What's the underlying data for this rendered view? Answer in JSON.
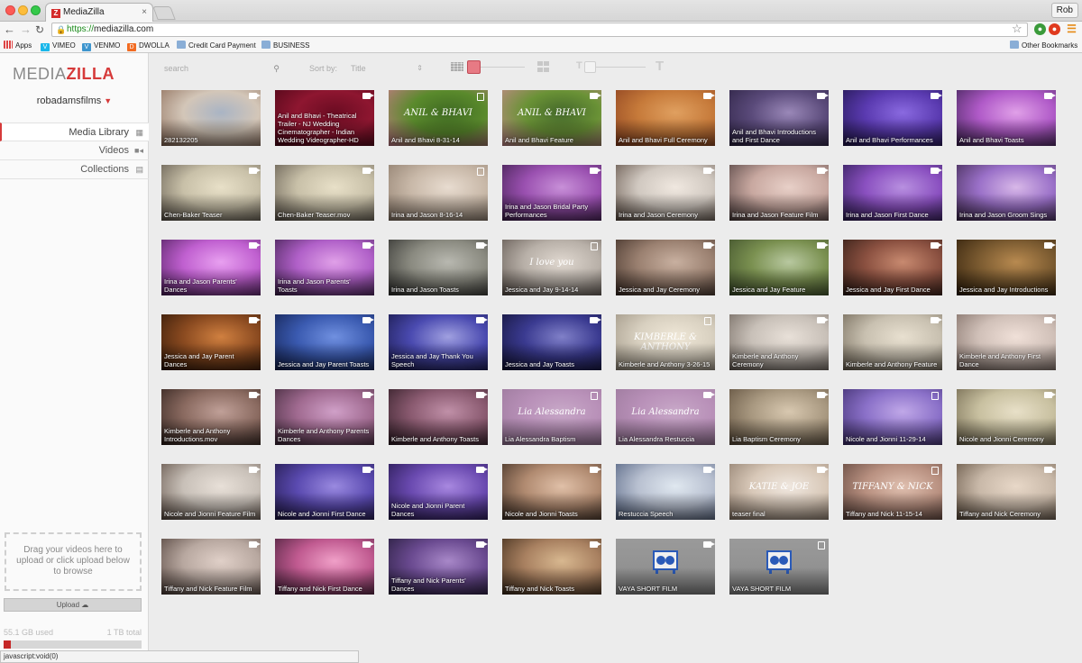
{
  "browser": {
    "tab_title": "MediaZilla",
    "favicon_letter": "Z",
    "url_scheme": "https://",
    "url_host": "mediazilla.com",
    "user": "Rob",
    "bookmarks": [
      "Apps",
      "VIMEO",
      "VENMO",
      "DWOLLA",
      "Credit Card Payment",
      "BUSINESS"
    ],
    "other_bookmarks": "Other Bookmarks",
    "status_text": "javascript:void(0)"
  },
  "sidebar": {
    "logo_media": "MEDIA",
    "logo_zilla": "ZILLA",
    "account": "robadamsfilms",
    "nav": [
      {
        "label": "Media Library",
        "icon": "grid-icon"
      },
      {
        "label": "Videos",
        "icon": "video-camera-icon"
      },
      {
        "label": "Collections",
        "icon": "collection-icon"
      }
    ],
    "dropzone_text": "Drag your videos here to upload or click upload below to browse",
    "upload_label": "Upload",
    "storage_used": "55.1 GB used",
    "storage_total": "1 TB total",
    "storage_fraction": 0.055
  },
  "controls": {
    "search_placeholder": "search",
    "sort_label": "Sort by:",
    "sort_value": "Title",
    "accent": "#e77a84"
  },
  "media": [
    {
      "title": "282132205",
      "type": "video",
      "c1": "#d3c6b8",
      "c2": "#8b6a56",
      "c3": "#a9b4c4"
    },
    {
      "title": "Anil and Bhavi - Theatrical Trailer - NJ Wedding Cinematographer - Indian Wedding Videographer-HD",
      "type": "video",
      "c1": "#8e1630",
      "c2": "#4a0616",
      "c3": "#6b0c22"
    },
    {
      "title": "Anil and Bhavi 8-31-14",
      "type": "collection",
      "c1": "#5a8a2c",
      "c2": "#c97b8a",
      "c3": "#3f6a22",
      "overlay": "ANIL & BHAVI"
    },
    {
      "title": "Anil and Bhavi Feature",
      "type": "video",
      "c1": "#6a9236",
      "c2": "#c98a8e",
      "c3": "#44682a",
      "overlay": "ANIL & BHAVI"
    },
    {
      "title": "Anil and Bhavi Full Ceremony",
      "type": "video",
      "c1": "#c67a3a",
      "c2": "#8a3e1e",
      "c3": "#e0a060"
    },
    {
      "title": "Anil and Bhavi Introductions and First Dance",
      "type": "video",
      "c1": "#5a4a7a",
      "c2": "#2a2040",
      "c3": "#9a88b8"
    },
    {
      "title": "Anil and Bhavi Performances",
      "type": "video",
      "c1": "#5a3ab0",
      "c2": "#1e1448",
      "c3": "#8a6ae0"
    },
    {
      "title": "Anil and Bhavi Toasts",
      "type": "video",
      "c1": "#b05ac8",
      "c2": "#3a2050",
      "c3": "#e0a0e8"
    },
    {
      "title": "Chen-Baker Teaser",
      "type": "video",
      "c1": "#c8c0a8",
      "c2": "#5a5248",
      "c3": "#e8e0c8"
    },
    {
      "title": "Chen-Baker Teaser.mov",
      "type": "video",
      "c1": "#c8c0a8",
      "c2": "#5a5248",
      "c3": "#e8e0c8"
    },
    {
      "title": "Irina and Jason 8-16-14",
      "type": "collection",
      "c1": "#c8b8a8",
      "c2": "#8a7868",
      "c3": "#e8dcd0"
    },
    {
      "title": "Irina and Jason Bridal Party Performances",
      "type": "video",
      "c1": "#9a50b0",
      "c2": "#3a1c48",
      "c3": "#c890d8"
    },
    {
      "title": "Irina and Jason Ceremony",
      "type": "video",
      "c1": "#d0c8c0",
      "c2": "#5a4a40",
      "c3": "#f0e8e0"
    },
    {
      "title": "Irina and Jason Feature Film",
      "type": "video",
      "c1": "#c8a8a0",
      "c2": "#4a3a3a",
      "c3": "#e8d0c8"
    },
    {
      "title": "Irina and Jason First Dance",
      "type": "video",
      "c1": "#8a50c0",
      "c2": "#2a1a50",
      "c3": "#b890e0"
    },
    {
      "title": "Irina and Jason Groom Sings",
      "type": "video",
      "c1": "#9a70c8",
      "c2": "#3a2448",
      "c3": "#d8b8e8"
    },
    {
      "title": "Irina and Jason Parents' Dances",
      "type": "video",
      "c1": "#c060d0",
      "c2": "#4a1c58",
      "c3": "#e8a0f0"
    },
    {
      "title": "Irina and Jason Parents' Toasts",
      "type": "video",
      "c1": "#b060c8",
      "c2": "#3a1c48",
      "c3": "#e0a0e8"
    },
    {
      "title": "Irina and Jason Toasts",
      "type": "video",
      "c1": "#8a8a80",
      "c2": "#2a2a28",
      "c3": "#b8b8b0"
    },
    {
      "title": "Jessica and Jay 9-14-14",
      "type": "collection",
      "c1": "#b8b0a8",
      "c2": "#5a504a",
      "c3": "#e0d8d0",
      "overlay": "I love you"
    },
    {
      "title": "Jessica and Jay Ceremony",
      "type": "video",
      "c1": "#9a8070",
      "c2": "#3a2a22",
      "c3": "#c8b0a0"
    },
    {
      "title": "Jessica and Jay Feature",
      "type": "video",
      "c1": "#7a9050",
      "c2": "#3a4a28",
      "c3": "#b8c8a0"
    },
    {
      "title": "Jessica and Jay First Dance",
      "type": "video",
      "c1": "#8a5040",
      "c2": "#2a1812",
      "c3": "#c88a70"
    },
    {
      "title": "Jessica and Jay Introductions",
      "type": "video",
      "c1": "#7a5a30",
      "c2": "#2a1a08",
      "c3": "#b88a50"
    },
    {
      "title": "Jessica and Jay Parent Dances",
      "type": "video",
      "c1": "#8a4a20",
      "c2": "#2a1406",
      "c3": "#d08040"
    },
    {
      "title": "Jessica and Jay Parent Toasts",
      "type": "video",
      "c1": "#3a5ab0",
      "c2": "#101c48",
      "c3": "#7090e0"
    },
    {
      "title": "Jessica and Jay Thank You Speech",
      "type": "video",
      "c1": "#4a4ab0",
      "c2": "#141440",
      "c3": "#a0a0e0"
    },
    {
      "title": "Jessica and Jay Toasts",
      "type": "video",
      "c1": "#3a3a90",
      "c2": "#101030",
      "c3": "#8080c8"
    },
    {
      "title": "Kimberle and Anthony 3-26-15",
      "type": "collection",
      "c1": "#d8d0c0",
      "c2": "#9a9080",
      "c3": "#f0e8d8",
      "overlay": "KIMBERLE & ANTHONY"
    },
    {
      "title": "Kimberle and Anthony Ceremony",
      "type": "video",
      "c1": "#c8c0b8",
      "c2": "#6a6058",
      "c3": "#e8e0d8"
    },
    {
      "title": "Kimberle and Anthony Feature",
      "type": "video",
      "c1": "#c8c0b0",
      "c2": "#6a6050",
      "c3": "#e8e0d0"
    },
    {
      "title": "Kimberle and Anthony First Dance",
      "type": "video",
      "c1": "#d0c0b8",
      "c2": "#7a6860",
      "c3": "#f0e0d8"
    },
    {
      "title": "Kimberle and Anthony Introductions.mov",
      "type": "video",
      "c1": "#8a6a60",
      "c2": "#2a1c18",
      "c3": "#c0a098"
    },
    {
      "title": "Kimberle and Anthony Parents Dances",
      "type": "video",
      "c1": "#a06a90",
      "c2": "#3a2434",
      "c3": "#d0a0c8"
    },
    {
      "title": "Kimberle and Anthony Toasts",
      "type": "video",
      "c1": "#8a5a70",
      "c2": "#2a1820",
      "c3": "#c090a8"
    },
    {
      "title": "Lia Alessandra Baptism",
      "type": "collection",
      "c1": "#b890b8",
      "c2": "#9a789a",
      "c3": "#c8a8c8",
      "overlay": "Lia Alessandra"
    },
    {
      "title": "Lia Alessandra Restuccia",
      "type": "video",
      "c1": "#b890b8",
      "c2": "#9a789a",
      "c3": "#c8a8c8",
      "overlay": "Lia Alessandra"
    },
    {
      "title": "Lia Baptism Ceremony",
      "type": "video",
      "c1": "#a89880",
      "c2": "#5a4a38",
      "c3": "#d8c8b0"
    },
    {
      "title": "Nicole and Jionni 11-29-14",
      "type": "collection",
      "c1": "#8a70c8",
      "c2": "#3a2a68",
      "c3": "#c0a8e8"
    },
    {
      "title": "Nicole and Jionni Ceremony",
      "type": "video",
      "c1": "#c8c0a0",
      "c2": "#6a6048",
      "c3": "#e8e0c8"
    },
    {
      "title": "Nicole and Jionni Feature Film",
      "type": "video",
      "c1": "#c8c0b8",
      "c2": "#5a4a40",
      "c3": "#e8e0d8"
    },
    {
      "title": "Nicole and Jionni First Dance",
      "type": "video",
      "c1": "#5a4ab0",
      "c2": "#1c1440",
      "c3": "#9a8ae0"
    },
    {
      "title": "Nicole and Jionni Parent Dances",
      "type": "video",
      "c1": "#6a4ab0",
      "c2": "#201448",
      "c3": "#a888e0"
    },
    {
      "title": "Nicole and Jionni Toasts",
      "type": "video",
      "c1": "#b08a70",
      "c2": "#3a2a20",
      "c3": "#e0c0a8"
    },
    {
      "title": "Restuccia Speech",
      "type": "video",
      "c1": "#b8c0d0",
      "c2": "#4a5a7a",
      "c3": "#e0e8f0"
    },
    {
      "title": "teaser final",
      "type": "video",
      "c1": "#d8c8b8",
      "c2": "#8a7868",
      "c3": "#f0e8e0",
      "overlay": "KATIE & JOE"
    },
    {
      "title": "Tiffany and Nick 11-15-14",
      "type": "collection",
      "c1": "#b89080",
      "c2": "#5a4038",
      "c3": "#e0c0b0",
      "overlay": "TIFFANY & NICK"
    },
    {
      "title": "Tiffany and Nick Ceremony",
      "type": "video",
      "c1": "#c8b8a8",
      "c2": "#5a4a3a",
      "c3": "#e8d8c8"
    },
    {
      "title": "Tiffany and Nick Feature Film",
      "type": "video",
      "c1": "#b8a8a0",
      "c2": "#4a3a34",
      "c3": "#e0d0c8"
    },
    {
      "title": "Tiffany and Nick First Dance",
      "type": "video",
      "c1": "#c05a90",
      "c2": "#401c34",
      "c3": "#f0a0c8"
    },
    {
      "title": "Tiffany and Nick Parents' Dances",
      "type": "video",
      "c1": "#6a4a90",
      "c2": "#201834",
      "c3": "#a888c8"
    },
    {
      "title": "Tiffany and Nick Toasts",
      "type": "video",
      "c1": "#a88060",
      "c2": "#3a2818",
      "c3": "#d8b890"
    },
    {
      "title": "VAYA SHORT FILM",
      "type": "video",
      "c1": "#8a8a8a",
      "c2": "#7a7a7a",
      "c3": "#9a9a9a",
      "placeholder": true
    },
    {
      "title": "VAYA SHORT FILM",
      "type": "collection",
      "c1": "#8a8a8a",
      "c2": "#7a7a7a",
      "c3": "#9a9a9a",
      "placeholder": true
    }
  ]
}
